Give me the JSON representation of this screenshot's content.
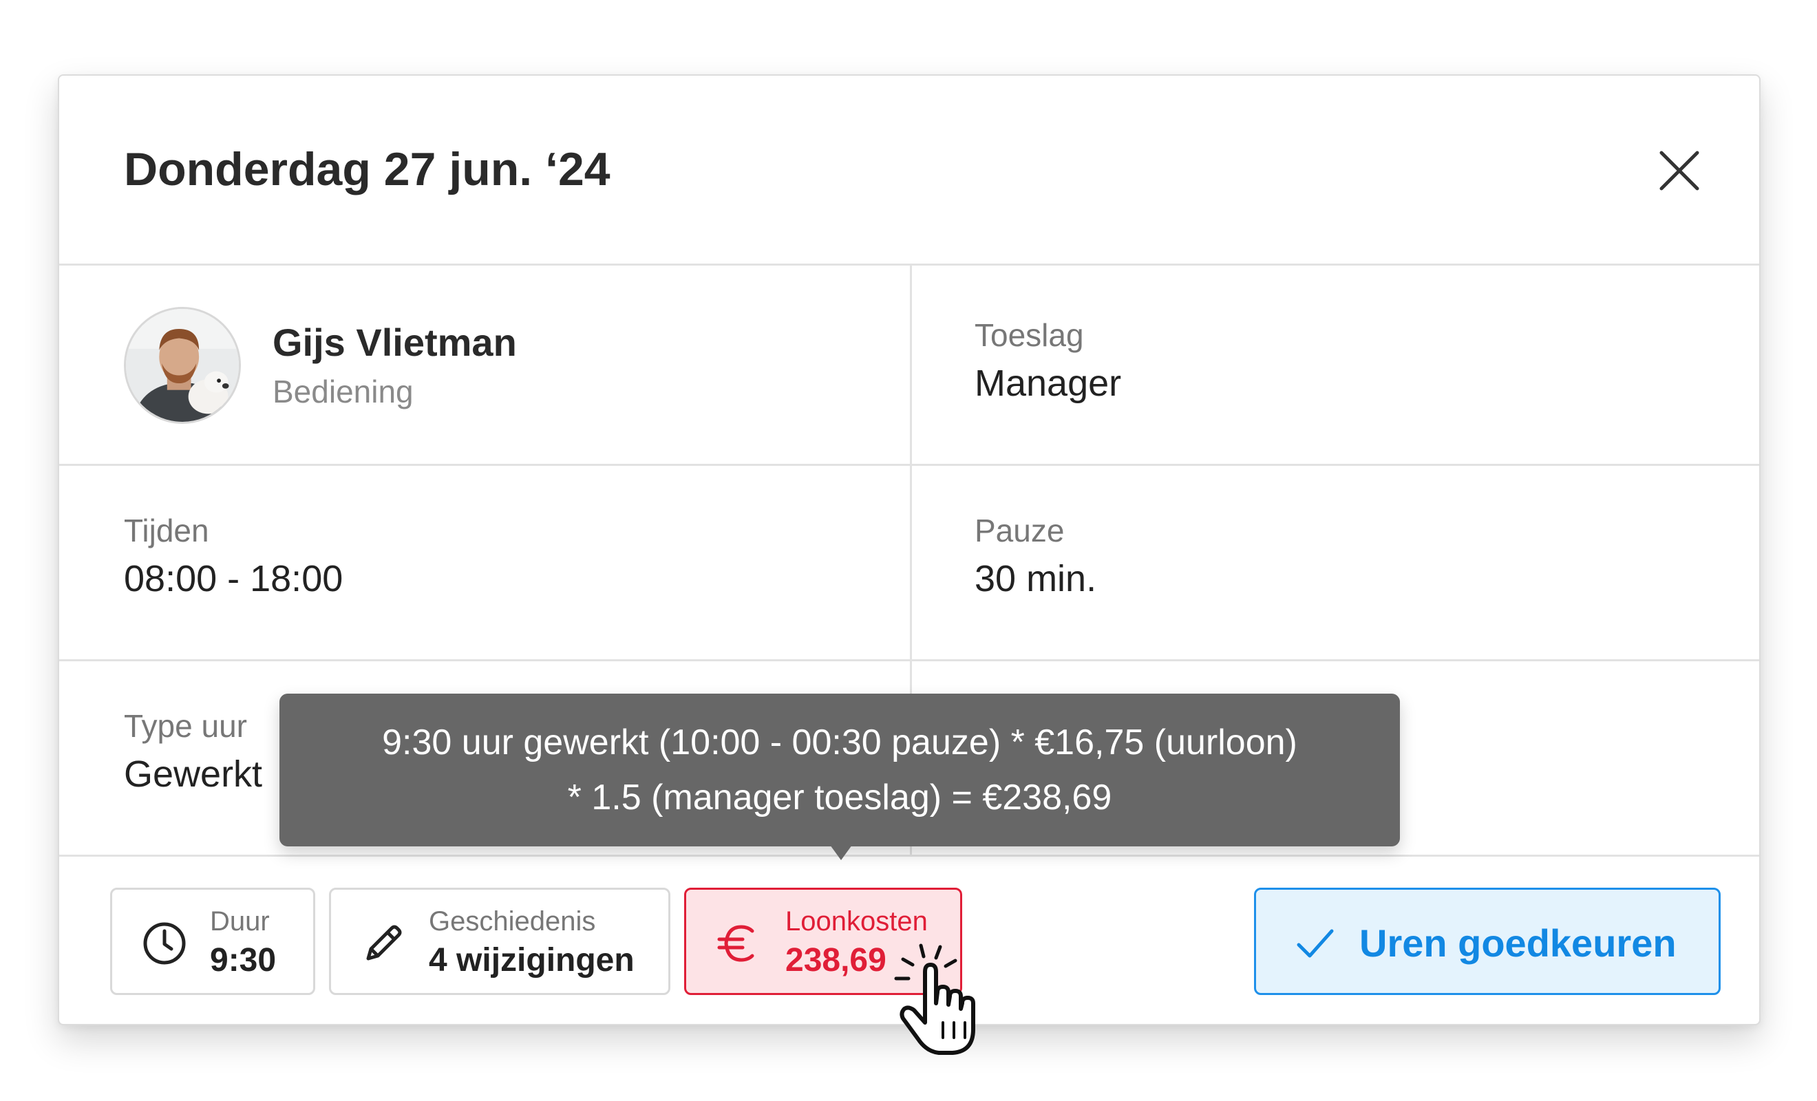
{
  "header": {
    "title": "Donderdag 27 jun. ‘24",
    "close_icon": "close-icon"
  },
  "employee": {
    "name": "Gijs Vlietman",
    "role": "Bediening",
    "avatar_icon": "avatar-photo"
  },
  "fields": {
    "toeslag": {
      "label": "Toeslag",
      "value": "Manager"
    },
    "tijden": {
      "label": "Tijden",
      "value": "08:00 - 18:00"
    },
    "pauze": {
      "label": "Pauze",
      "value": "30 min."
    },
    "type_uur": {
      "label": "Type uur",
      "value": "Gewerkt"
    }
  },
  "tooltip": {
    "line1": "9:30 uur gewerkt (10:00 - 00:30 pauze) * €16,75 (uurloon)",
    "line2": "* 1.5 (manager toeslag) = €238,69"
  },
  "footer": {
    "duur": {
      "label": "Duur",
      "value": "9:30",
      "icon": "clock-icon"
    },
    "geschiedenis": {
      "label": "Geschiedenis",
      "value": "4 wijzigingen",
      "icon": "pencil-icon"
    },
    "loonkosten": {
      "label": "Loonkosten",
      "value": "238,69",
      "icon": "euro-icon"
    },
    "approve": {
      "label": "Uren goedkeuren",
      "icon": "checkmark-icon"
    }
  },
  "colors": {
    "accent_blue": "#1288e3",
    "cost_red": "#e01e37",
    "tooltip_bg": "#676767"
  }
}
